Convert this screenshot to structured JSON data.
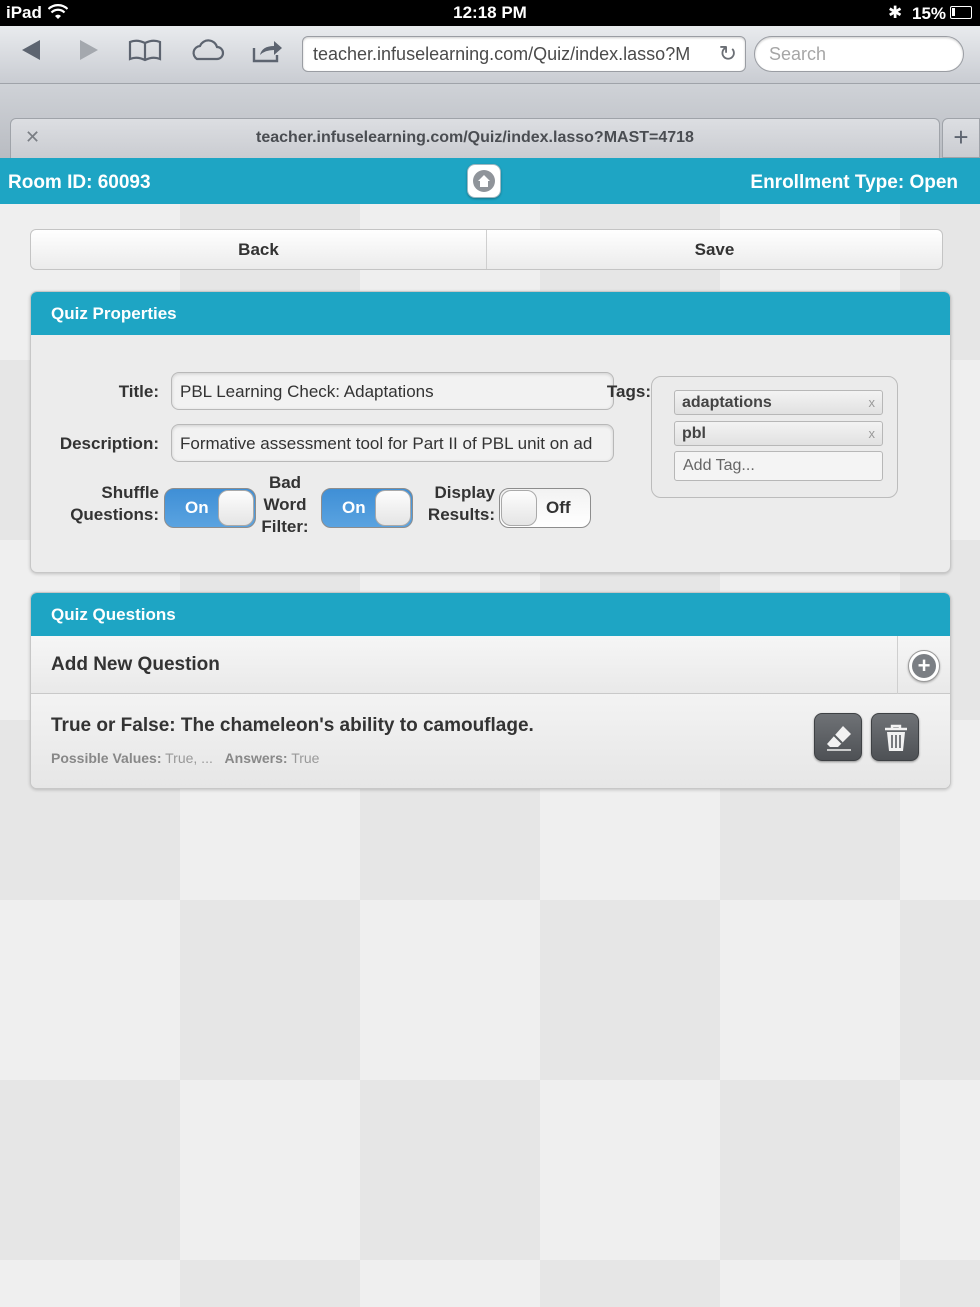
{
  "status_bar": {
    "device": "iPad",
    "time": "12:18 PM",
    "battery": "15%"
  },
  "browser": {
    "url": "teacher.infuselearning.com/Quiz/index.lasso?M",
    "search_placeholder": "Search",
    "tab_title": "teacher.infuselearning.com/Quiz/index.lasso?MAST=4718"
  },
  "header": {
    "room_id": "Room ID: 60093",
    "enrollment": "Enrollment Type: Open"
  },
  "actions": {
    "back": "Back",
    "save": "Save"
  },
  "quiz_properties": {
    "heading": "Quiz Properties",
    "title_label": "Title:",
    "title_value": "PBL Learning Check: Adaptations",
    "description_label": "Description:",
    "description_value": "Formative assessment tool for Part II of PBL unit on ad",
    "shuffle_label_1": "Shuffle",
    "shuffle_label_2": "Questions:",
    "shuffle_state": "On",
    "badword_label_1": "Bad",
    "badword_label_2": "Word",
    "badword_label_3": "Filter:",
    "badword_state": "On",
    "display_label_1": "Display",
    "display_label_2": "Results:",
    "display_state": "Off",
    "tags_label": "Tags:",
    "tags": [
      "adaptations",
      "pbl"
    ],
    "tag_remove": "x",
    "add_tag_placeholder": "Add Tag..."
  },
  "quiz_questions": {
    "heading": "Quiz Questions",
    "add_new": "Add New Question",
    "items": [
      {
        "text": "True or False: The chameleon's ability to camouflage.",
        "possible_label": "Possible Values:",
        "possible_value": "True, ...",
        "answers_label": "Answers:",
        "answers_value": "True"
      }
    ]
  },
  "colors": {
    "accent": "#1ea5c4",
    "toggle_on": "#4a98dc"
  }
}
